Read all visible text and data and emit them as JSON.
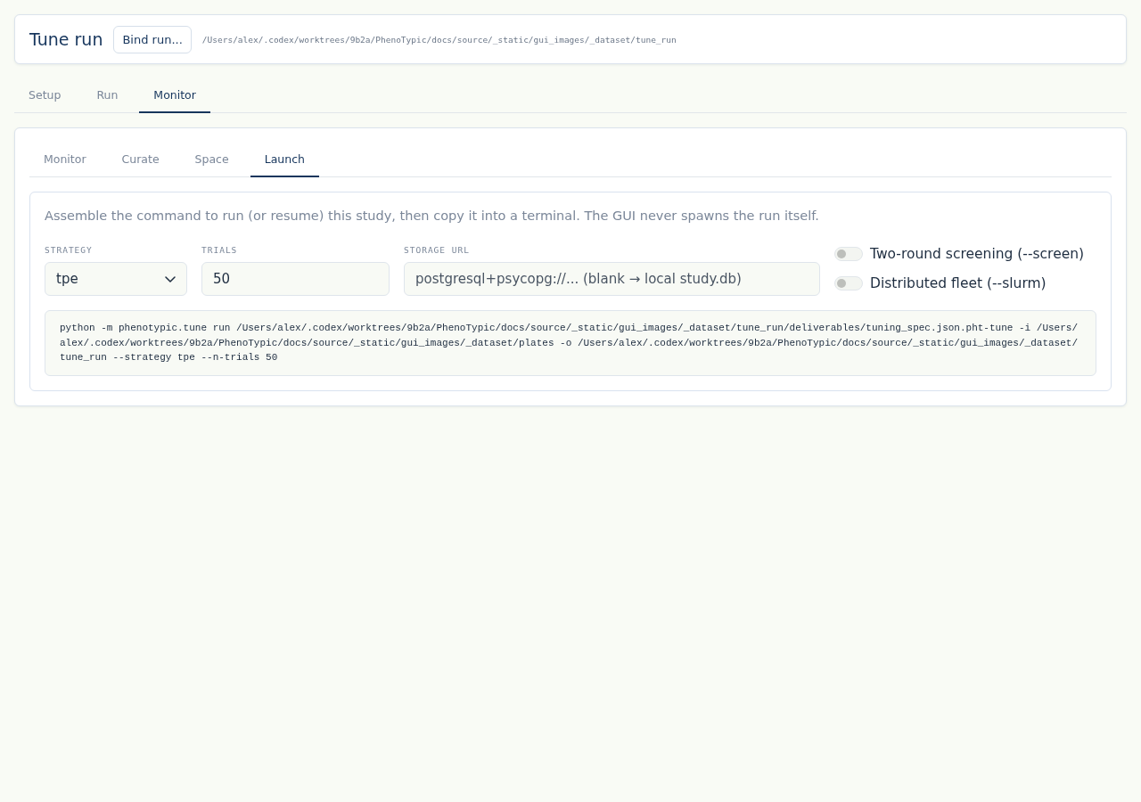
{
  "header": {
    "title": "Tune run",
    "bind_button": "Bind run...",
    "path": "/Users/alex/.codex/worktrees/9b2a/PhenoTypic/docs/source/_static/gui_images/_dataset/tune_run"
  },
  "tabs": [
    {
      "label": "Setup",
      "selected": false
    },
    {
      "label": "Run",
      "selected": false
    },
    {
      "label": "Monitor",
      "selected": true
    }
  ],
  "subtabs": [
    {
      "label": "Monitor",
      "selected": false
    },
    {
      "label": "Curate",
      "selected": false
    },
    {
      "label": "Space",
      "selected": false
    },
    {
      "label": "Launch",
      "selected": true
    }
  ],
  "launch": {
    "description": "Assemble the command to run (or resume) this study, then copy it into a terminal. The GUI never spawns the run itself.",
    "fields": [
      {
        "kind": "select",
        "label": "STRATEGY",
        "value": "tpe"
      },
      {
        "kind": "input",
        "label": "TRIALS",
        "value": "50"
      },
      {
        "kind": "input",
        "label": "STORAGE URL",
        "placeholder": "postgresql+psycopg://... (blank → local study.db)"
      }
    ],
    "toggles": [
      {
        "label": "Two-round screening (--screen)",
        "on": false
      },
      {
        "label": "Distributed fleet (--slurm)",
        "on": false
      }
    ],
    "command": "python -m phenotypic.tune run /Users/alex/.codex/worktrees/9b2a/PhenoTypic/docs/source/_static/gui_images/_dataset/tune_run/deliverables/tuning_spec.json.pht-tune -i /Users/alex/.codex/worktrees/9b2a/PhenoTypic/docs/source/_static/gui_images/_dataset/plates -o /Users/alex/.codex/worktrees/9b2a/PhenoTypic/docs/source/_static/gui_images/_dataset/tune_run --strategy tpe --n-trials 50"
  }
}
